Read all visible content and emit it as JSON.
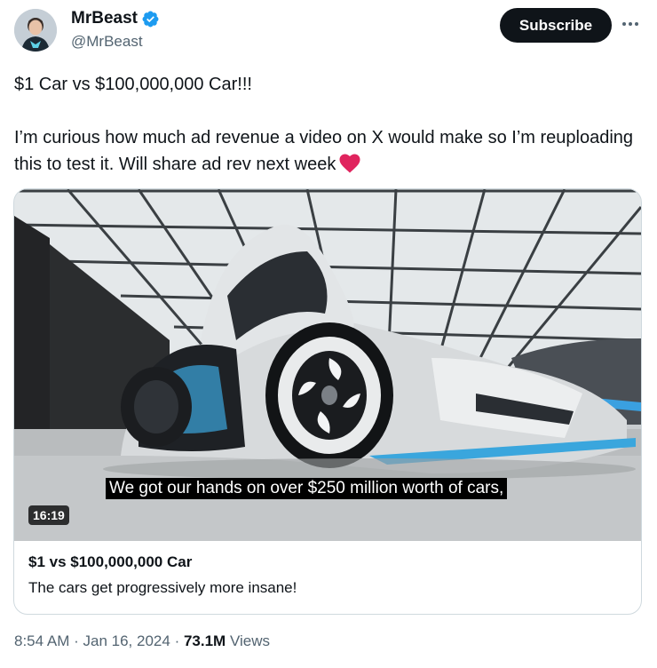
{
  "author": {
    "name": "MrBeast",
    "handle": "@MrBeast",
    "verified": true,
    "avatar_icon": "avatar-icon"
  },
  "actions": {
    "subscribe_label": "Subscribe",
    "more_icon": "more-horizontal-icon"
  },
  "tweet": {
    "line1": "$1 Car vs $100,000,000 Car!!!",
    "line2": "I’m curious how much ad revenue a video on X would make so I’m reuploading this to test it. Will share ad rev next week",
    "emoji": "red-heart-icon"
  },
  "video": {
    "subtitle": "We got our hands on over $250 million worth of cars,",
    "duration": "16:19",
    "card_title": "$1 vs $100,000,000 Car",
    "card_description": "The cars get progressively more insane!"
  },
  "meta": {
    "time": "8:54 AM",
    "separator": "·",
    "date": "Jan 16, 2024",
    "views_count": "73.1M",
    "views_label": "Views"
  },
  "colors": {
    "text": "#0f1419",
    "secondary": "#536471",
    "verified": "#1d9bf0",
    "heart": "#e0245e",
    "button_bg": "#0f1419"
  }
}
